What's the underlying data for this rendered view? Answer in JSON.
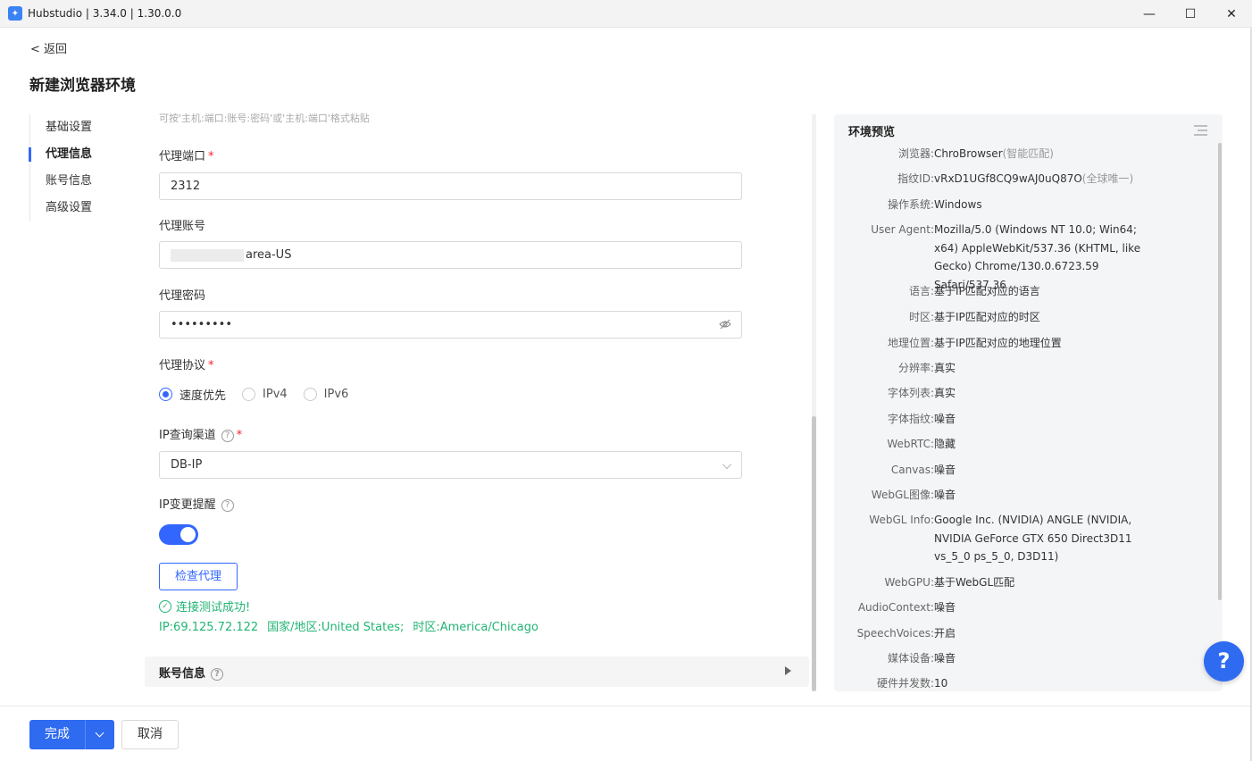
{
  "window": {
    "title": "Hubstudio | 3.34.0 | 1.30.0.0"
  },
  "header": {
    "back": "< 返回",
    "title": "新建浏览器环境"
  },
  "nav": {
    "items": [
      "基础设置",
      "代理信息",
      "账号信息",
      "高级设置"
    ],
    "active": "代理信息"
  },
  "form": {
    "hint": "可按'主机:端口:账号:密码'或'主机:端口'格式粘贴",
    "port_label": "代理端口",
    "port_value": "2312",
    "account_label": "代理账号",
    "account_value": "area-US",
    "password_label": "代理密码",
    "password_value": "•••••••••",
    "protocol_label": "代理协议",
    "protocol_options": [
      "速度优先",
      "IPv4",
      "IPv6"
    ],
    "protocol_selected": "速度优先",
    "channel_label": "IP查询渠道",
    "channel_value": "DB-IP",
    "ip_change_label": "IP变更提醒",
    "ip_change_enabled": true,
    "check_button": "检查代理",
    "success_text": "连接测试成功!",
    "result_ip": "IP:69.125.72.122",
    "result_country": "国家/地区:United States;",
    "result_tz": "时区:America/Chicago",
    "account_section_title": "账号信息"
  },
  "preview": {
    "title": "环境预览",
    "rows": [
      {
        "key": "浏览器:",
        "value": "ChroBrowser",
        "extra": "(智能匹配)"
      },
      {
        "key": "指纹ID:",
        "value": "vRxD1UGf8CQ9wAJ0uQ87O",
        "extra": "(全球唯一)"
      },
      {
        "key": "操作系统:",
        "value": "Windows"
      },
      {
        "key": "User Agent:",
        "value": "Mozilla/5.0 (Windows NT 10.0; Win64; x64) AppleWebKit/537.36 (KHTML, like Gecko) Chrome/130.0.6723.59 Safari/537.36"
      },
      {
        "key": "语言:",
        "value": "基于IP匹配对应的语言"
      },
      {
        "key": "时区:",
        "value": "基于IP匹配对应的时区"
      },
      {
        "key": "地理位置:",
        "value": "基于IP匹配对应的地理位置"
      },
      {
        "key": "分辨率:",
        "value": "真实"
      },
      {
        "key": "字体列表:",
        "value": "真实"
      },
      {
        "key": "字体指纹:",
        "value": "噪音"
      },
      {
        "key": "WebRTC:",
        "value": "隐藏"
      },
      {
        "key": "Canvas:",
        "value": "噪音"
      },
      {
        "key": "WebGL图像:",
        "value": "噪音"
      },
      {
        "key": "WebGL Info:",
        "value": "Google Inc. (NVIDIA) ANGLE (NVIDIA, NVIDIA GeForce GTX 650 Direct3D11 vs_5_0 ps_5_0, D3D11)"
      },
      {
        "key": "WebGPU:",
        "value": "基于WebGL匹配"
      },
      {
        "key": "AudioContext:",
        "value": "噪音"
      },
      {
        "key": "SpeechVoices:",
        "value": "开启"
      },
      {
        "key": "媒体设备:",
        "value": "噪音"
      },
      {
        "key": "硬件并发数:",
        "value": "10"
      }
    ]
  },
  "footer": {
    "done": "完成",
    "cancel": "取消"
  },
  "fab": "?",
  "colors": {
    "primary": "#2e6bf0",
    "success": "#22b573",
    "required": "#f5222d"
  }
}
